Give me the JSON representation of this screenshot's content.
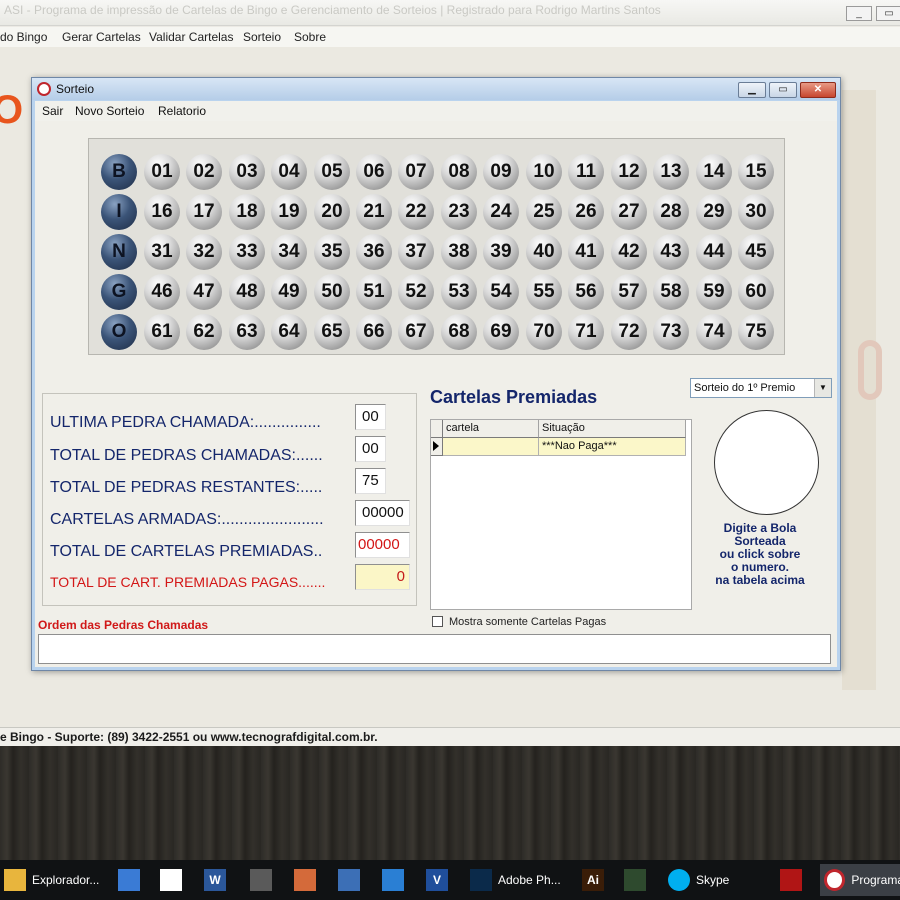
{
  "outer": {
    "title": "ASI - Programa de impressão de Cartelas de Bingo e Gerenciamento de Sorteios | Registrado para Rodrigo Martins Santos",
    "menu": [
      "do Bingo",
      "Gerar Cartelas",
      "Validar Cartelas",
      "Sorteio",
      "Sobre"
    ],
    "status": "e Bingo - Suporte: (89) 3422-2551 ou www.tecnografdigital.com.br."
  },
  "window": {
    "title": "Sorteio",
    "menu": [
      "Sair",
      "Novo Sorteio",
      "Relatorio"
    ]
  },
  "board": {
    "rows": [
      {
        "letter": "B",
        "numbers": [
          "01",
          "02",
          "03",
          "04",
          "05",
          "06",
          "07",
          "08",
          "09",
          "10",
          "11",
          "12",
          "13",
          "14",
          "15"
        ]
      },
      {
        "letter": "I",
        "numbers": [
          "16",
          "17",
          "18",
          "19",
          "20",
          "21",
          "22",
          "23",
          "24",
          "25",
          "26",
          "27",
          "28",
          "29",
          "30"
        ]
      },
      {
        "letter": "N",
        "numbers": [
          "31",
          "32",
          "33",
          "34",
          "35",
          "36",
          "37",
          "38",
          "39",
          "40",
          "41",
          "42",
          "43",
          "44",
          "45"
        ]
      },
      {
        "letter": "G",
        "numbers": [
          "46",
          "47",
          "48",
          "49",
          "50",
          "51",
          "52",
          "53",
          "54",
          "55",
          "56",
          "57",
          "58",
          "59",
          "60"
        ]
      },
      {
        "letter": "O",
        "numbers": [
          "61",
          "62",
          "63",
          "64",
          "65",
          "66",
          "67",
          "68",
          "69",
          "70",
          "71",
          "72",
          "73",
          "74",
          "75"
        ]
      }
    ]
  },
  "stats": {
    "ultima_label": "ULTIMA PEDRA CHAMADA:...............",
    "ultima_value": "00",
    "chamadas_label": "TOTAL DE PEDRAS CHAMADAS:......",
    "chamadas_value": "00",
    "restantes_label": "TOTAL DE PEDRAS RESTANTES:.....",
    "restantes_value": "75",
    "armadas_label": "CARTELAS ARMADAS:.......................",
    "armadas_value": "00000",
    "premiadas_label": "TOTAL DE CARTELAS PREMIADAS..",
    "premiadas_value": "00000",
    "pagas_label": "TOTAL DE CART. PREMIADAS PAGAS.......",
    "pagas_value": "0"
  },
  "prizes": {
    "heading": "Cartelas Premiadas",
    "columns": [
      "cartela",
      "Situação"
    ],
    "rows": [
      {
        "cartela": "",
        "situacao": "***Nao Paga***"
      }
    ],
    "select_value": "Sorteio do 1º Premio",
    "checkbox_label": "Mostra somente Cartelas Pagas"
  },
  "hint": [
    "Digite a Bola",
    "Sorteada",
    "ou click sobre",
    "o  numero.",
    "na tabela acima"
  ],
  "order_label": "Ordem das Pedras Chamadas",
  "taskbar": {
    "items": [
      {
        "icon": "folder-icon",
        "label": "Explorador..."
      },
      {
        "icon": "store-icon",
        "label": ""
      },
      {
        "icon": "mail-icon",
        "label": ""
      },
      {
        "icon": "word-icon",
        "label": "W"
      },
      {
        "icon": "calculator-icon",
        "label": ""
      },
      {
        "icon": "paint-icon",
        "label": ""
      },
      {
        "icon": "app-icon",
        "label": ""
      },
      {
        "icon": "photos-icon",
        "label": ""
      },
      {
        "icon": "visio-icon",
        "label": "V"
      },
      {
        "icon": "photoshop-icon",
        "label": "Adobe Ph..."
      },
      {
        "icon": "illustrator-icon",
        "label": "Ai"
      },
      {
        "icon": "app2-icon",
        "label": ""
      },
      {
        "icon": "skype-icon",
        "label": "Skype"
      },
      {
        "icon": "app3-icon",
        "label": ""
      },
      {
        "icon": "bingo-program-icon",
        "label": "Programa"
      }
    ]
  },
  "colors": {
    "accent": "#14266b",
    "alert": "#d31616",
    "titlebar": "#b9d3ee"
  }
}
